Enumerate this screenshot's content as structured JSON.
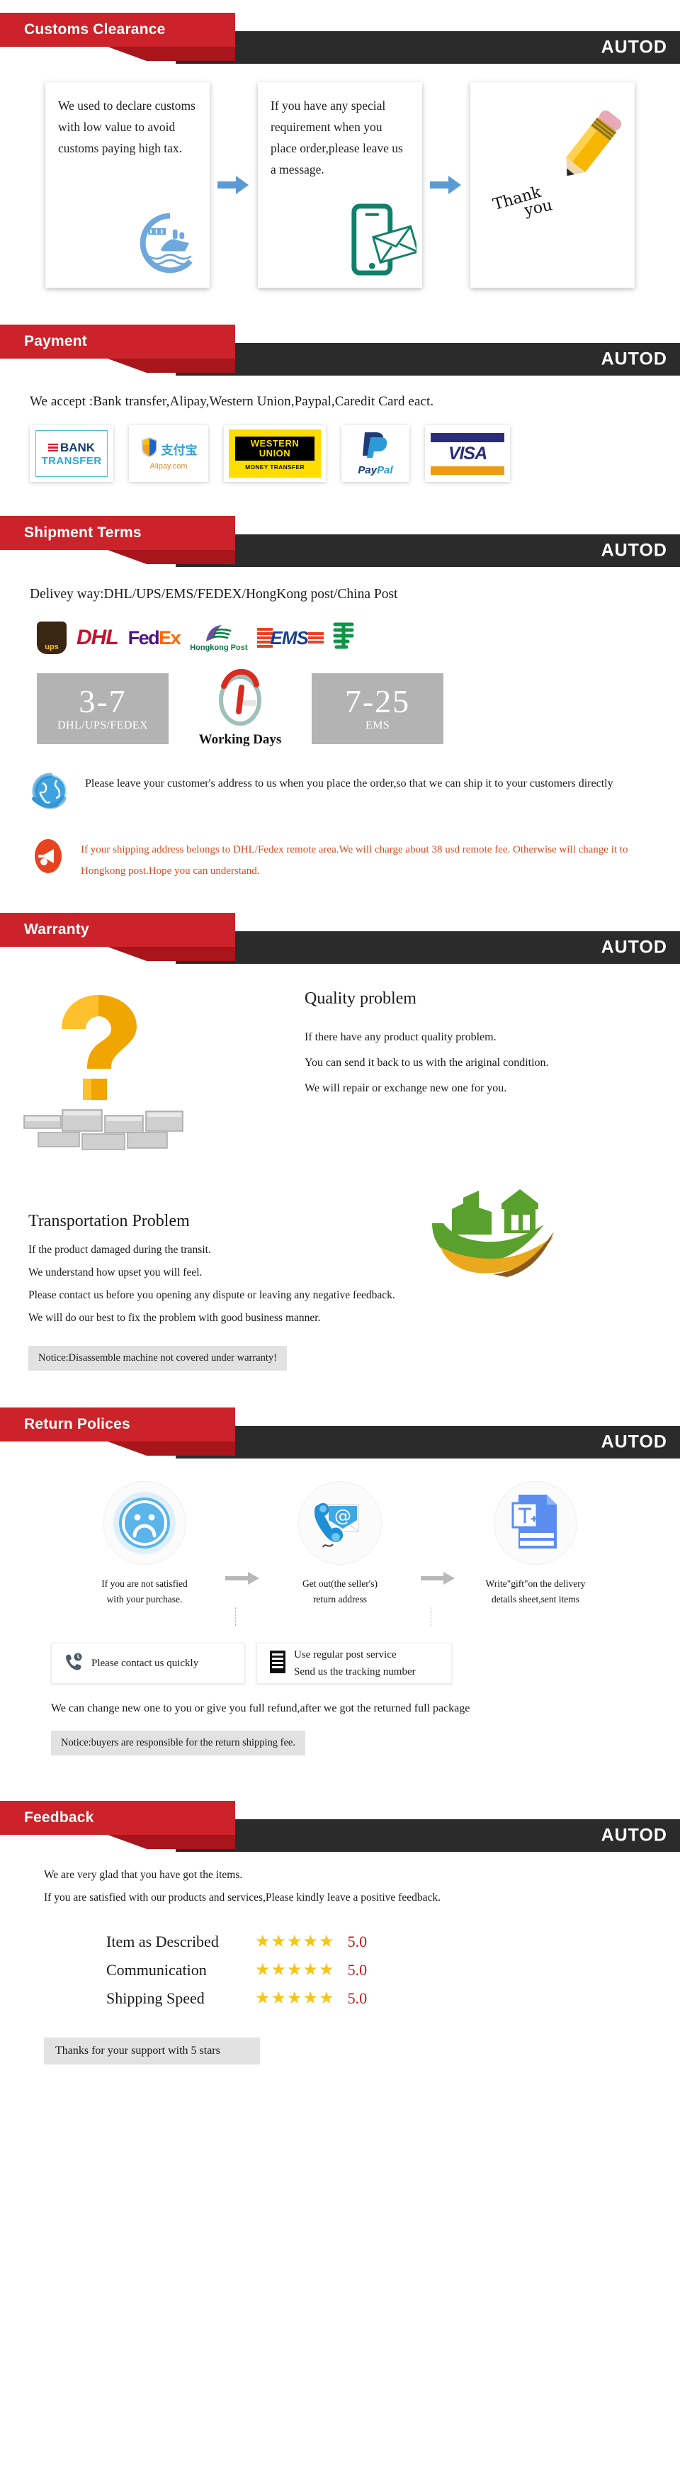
{
  "brand": "AUTOD",
  "colors": {
    "accent_red": "#cc2229",
    "fold_red": "#a8151b",
    "dark_bar": "#2b2b2b",
    "warn_orange": "#e04a1f",
    "star_gold": "#f5c518",
    "rating_red": "#cc1111",
    "grey_box": "#b3b3b3"
  },
  "sections": {
    "customs": {
      "title": "Customs Clearance",
      "cards": [
        {
          "text": "We used to declare customs with low value to avoid customs paying high tax.",
          "icon": "ship-circle-icon"
        },
        {
          "text": "If you have any special requirement when you place order,please leave us a message.",
          "icon": "phone-message-icon"
        },
        {
          "icon": "pencil-icon",
          "thanks_line1": "Thank",
          "thanks_line2": "you"
        }
      ]
    },
    "payment": {
      "title": "Payment",
      "intro": "We accept :Bank transfer,Alipay,Western Union,Paypal,Caredit Card eact.",
      "methods": [
        {
          "name": "bank-transfer-logo",
          "line1": "BANK",
          "line2": "TRANSFER"
        },
        {
          "name": "alipay-logo",
          "cn": "支付宝",
          "domain": "Alipay.com"
        },
        {
          "name": "western-union-logo",
          "line1": "WESTERN",
          "line2": "UNION",
          "sub": "MONEY TRANSFER"
        },
        {
          "name": "paypal-logo",
          "a": "Pay",
          "b": "Pal"
        },
        {
          "name": "visa-logo",
          "label": "VISA"
        }
      ]
    },
    "shipment": {
      "title": "Shipment Terms",
      "intro": "Delivey way:DHL/UPS/EMS/FEDEX/HongKong post/China Post",
      "carriers": [
        {
          "name": "ups-logo",
          "label": "ups"
        },
        {
          "name": "dhl-logo",
          "label": "DHL"
        },
        {
          "name": "fedex-logo",
          "a": "Fed",
          "b": "Ex"
        },
        {
          "name": "hongkong-post-logo",
          "a": "Hongkong ",
          "b": "Post"
        },
        {
          "name": "ems-logo",
          "label": "EMS"
        },
        {
          "name": "china-post-logo",
          "label": "中"
        }
      ],
      "times": [
        {
          "value": "3-7",
          "sub": "DHL/UPS/FEDEX"
        },
        {
          "value": "7-25",
          "sub": "EMS"
        }
      ],
      "middle_label": "Working Days",
      "note_address": "Please leave your customer's address to us when you place the order,so that we can ship it to your customers directly",
      "note_remote": "If your shipping address belongs to DHL/Fedex remote area.We will charge about 38 usd remote fee. Otherwise will change it to Hongkong post.Hope you can understand."
    },
    "warranty": {
      "title": "Warranty",
      "quality_heading": "Quality problem",
      "quality_lines": [
        "If there have any product quality problem.",
        "You can send it back to us with the ariginal condition.",
        "We will repair or exchange new one for you."
      ],
      "transport_heading": "Transportation Problem",
      "transport_lines": [
        "If the product damaged during the transit.",
        "We understand how upset you will feel.",
        "Please contact us before you opening any dispute or leaving any negative feedback.",
        "We will do our best to fix the problem with good business manner."
      ],
      "notice": "Notice:Disassemble machine not covered under warranty!"
    },
    "returns": {
      "title": "Return Polices",
      "steps": [
        {
          "icon": "sad-face-icon",
          "caption_line1": "If you are not satisfied",
          "caption_line2": "with your purchase."
        },
        {
          "icon": "phone-email-icon",
          "caption_line1": "Get out(the seller's)",
          "caption_line2": "return address"
        },
        {
          "icon": "document-text-icon",
          "caption_line1": "Write\"gift\"on the delivery",
          "caption_line2": "details sheet,sent items"
        }
      ],
      "boxes": [
        {
          "icon": "phone-clock-icon",
          "line1": "Please contact us quickly",
          "line2": ""
        },
        {
          "icon": "post-list-icon",
          "line1": "Use regular post service",
          "line2": "Send us the tracking number"
        }
      ],
      "refund_line": "We can change new one to you or give you full refund,after we got the returned full package",
      "notice": "Notice:buyers are responsible for the return shipping fee."
    },
    "feedback": {
      "title": "Feedback",
      "intro_line1": "We are very glad that you have got the items.",
      "intro_line2": "If you are satisfied with our products and services,Please kindly leave a positive feedback.",
      "ratings": [
        {
          "label": "Item as Described",
          "stars": "★★★★★",
          "value": "5.0"
        },
        {
          "label": "Communication",
          "stars": "★★★★★",
          "value": "5.0"
        },
        {
          "label": "Shipping Speed",
          "stars": "★★★★★",
          "value": "5.0"
        }
      ],
      "thanks": "Thanks for your support with 5 stars"
    }
  }
}
